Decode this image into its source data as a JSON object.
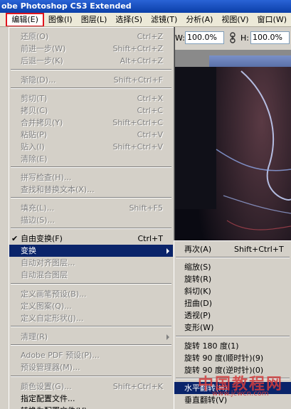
{
  "window": {
    "title": "obe Photoshop CS3 Extended"
  },
  "menubar": {
    "items": [
      "编辑(E)",
      "图像(I)",
      "图层(L)",
      "选择(S)",
      "滤镜(T)",
      "分析(A)",
      "视图(V)",
      "窗口(W)"
    ],
    "active_index": 0
  },
  "options": {
    "w_label": "W:",
    "w_value": "100.0%",
    "h_label": "H:",
    "h_value": "100.0%"
  },
  "edit_menu": {
    "items": [
      {
        "label": "还原(O)",
        "shortcut": "Ctrl+Z",
        "enabled": false
      },
      {
        "label": "前进一步(W)",
        "shortcut": "Shift+Ctrl+Z",
        "enabled": false
      },
      {
        "label": "后退一步(K)",
        "shortcut": "Alt+Ctrl+Z",
        "enabled": false
      },
      {
        "label": "渐隐(D)...",
        "shortcut": "Shift+Ctrl+F",
        "enabled": false
      },
      {
        "label": "剪切(T)",
        "shortcut": "Ctrl+X",
        "enabled": false
      },
      {
        "label": "拷贝(C)",
        "shortcut": "Ctrl+C",
        "enabled": false
      },
      {
        "label": "合并拷贝(Y)",
        "shortcut": "Shift+Ctrl+C",
        "enabled": false
      },
      {
        "label": "粘贴(P)",
        "shortcut": "Ctrl+V",
        "enabled": false
      },
      {
        "label": "贴入(I)",
        "shortcut": "Shift+Ctrl+V",
        "enabled": false
      },
      {
        "label": "清除(E)",
        "shortcut": "",
        "enabled": false
      },
      {
        "label": "拼写检查(H)...",
        "shortcut": "",
        "enabled": false
      },
      {
        "label": "查找和替换文本(X)...",
        "shortcut": "",
        "enabled": false
      },
      {
        "label": "填充(L)...",
        "shortcut": "Shift+F5",
        "enabled": false
      },
      {
        "label": "描边(S)...",
        "shortcut": "",
        "enabled": false
      },
      {
        "label": "自由变换(F)",
        "shortcut": "Ctrl+T",
        "enabled": true,
        "checked": true
      },
      {
        "label": "变换",
        "shortcut": "",
        "enabled": true,
        "highlighted": true,
        "submenu": true
      },
      {
        "label": "自动对齐图层...",
        "shortcut": "",
        "enabled": false
      },
      {
        "label": "自动混合图层",
        "shortcut": "",
        "enabled": false
      },
      {
        "label": "定义画笔预设(B)...",
        "shortcut": "",
        "enabled": false
      },
      {
        "label": "定义图案(Q)...",
        "shortcut": "",
        "enabled": false
      },
      {
        "label": "定义自定形状(J)...",
        "shortcut": "",
        "enabled": false
      },
      {
        "label": "清理(R)",
        "shortcut": "",
        "enabled": false,
        "submenu": true
      },
      {
        "label": "Adobe PDF 预设(P)...",
        "shortcut": "",
        "enabled": false
      },
      {
        "label": "预设管理器(M)...",
        "shortcut": "",
        "enabled": false
      },
      {
        "label": "颜色设置(G)...",
        "shortcut": "Shift+Ctrl+K",
        "enabled": false
      },
      {
        "label": "指定配置文件...",
        "shortcut": "",
        "enabled": true
      },
      {
        "label": "转换为配置文件(V)...",
        "shortcut": "",
        "enabled": true
      }
    ]
  },
  "transform_submenu": {
    "items": [
      {
        "label": "再次(A)",
        "shortcut": "Shift+Ctrl+T"
      },
      {
        "label": "缩放(S)",
        "shortcut": ""
      },
      {
        "label": "旋转(R)",
        "shortcut": ""
      },
      {
        "label": "斜切(K)",
        "shortcut": ""
      },
      {
        "label": "扭曲(D)",
        "shortcut": ""
      },
      {
        "label": "透视(P)",
        "shortcut": ""
      },
      {
        "label": "变形(W)",
        "shortcut": ""
      },
      {
        "label": "旋转 180 度(1)",
        "shortcut": ""
      },
      {
        "label": "旋转 90 度(顺时针)(9)",
        "shortcut": ""
      },
      {
        "label": "旋转 90 度(逆时针)(0)",
        "shortcut": ""
      },
      {
        "label": "水平翻转(H)",
        "shortcut": "",
        "highlighted": true
      },
      {
        "label": "垂直翻转(V)",
        "shortcut": ""
      }
    ]
  },
  "watermark": {
    "text": "中国教程网",
    "url": "www.jcwcn.com"
  },
  "colors": {
    "menu_bg": "#d4d0c8",
    "highlight": "#0a246a",
    "active_outline": "#e0141d"
  }
}
